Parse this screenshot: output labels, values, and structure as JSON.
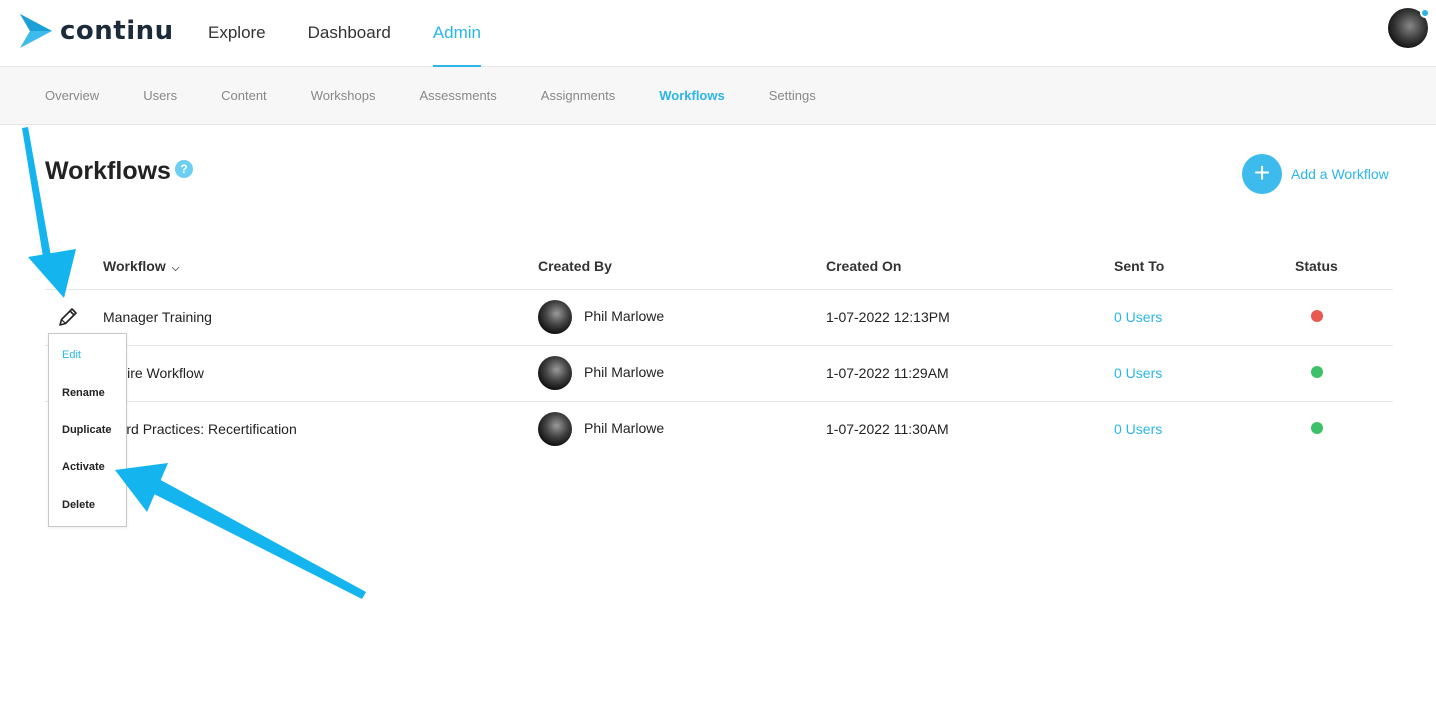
{
  "app": {
    "brand": "continu",
    "main_nav": [
      "Explore",
      "Dashboard",
      "Admin"
    ],
    "active_main_nav": "Admin"
  },
  "sub_nav": {
    "items": [
      "Overview",
      "Users",
      "Content",
      "Workshops",
      "Assessments",
      "Assignments",
      "Workflows",
      "Settings"
    ],
    "active": "Workflows"
  },
  "page": {
    "title": "Workflows",
    "help_glyph": "?",
    "add_label": "Add a Workflow",
    "add_glyph": "+"
  },
  "table": {
    "columns": [
      "Workflow",
      "Created By",
      "Created On",
      "Sent To",
      "Status"
    ],
    "rows": [
      {
        "workflow": "Manager Training",
        "created_by": "Phil Marlowe",
        "created_on": "1-07-2022 12:13PM",
        "sent_to": "0 Users",
        "status": "inactive"
      },
      {
        "workflow": "w Hire Workflow",
        "created_by": "Phil Marlowe",
        "created_on": "1-07-2022 11:29AM",
        "sent_to": "0 Users",
        "status": "active"
      },
      {
        "workflow": "ndard Practices: Recertification",
        "created_by": "Phil Marlowe",
        "created_on": "1-07-2022 11:30AM",
        "sent_to": "0 Users",
        "status": "active"
      }
    ]
  },
  "row_menu": {
    "items": [
      "Edit",
      "Rename",
      "Duplicate",
      "Activate",
      "Delete"
    ]
  },
  "colors": {
    "accent": "#2bb5e8",
    "status_active": "#3cc16a",
    "status_inactive": "#e8584f",
    "annotation_arrow": "#14b4ee"
  },
  "icons": {
    "logo": "chevron-arrow-logo-icon",
    "help": "question-circle-icon",
    "add": "plus-circle-icon",
    "sort": "chevron-down-icon",
    "row_action": "pencil-icon"
  }
}
